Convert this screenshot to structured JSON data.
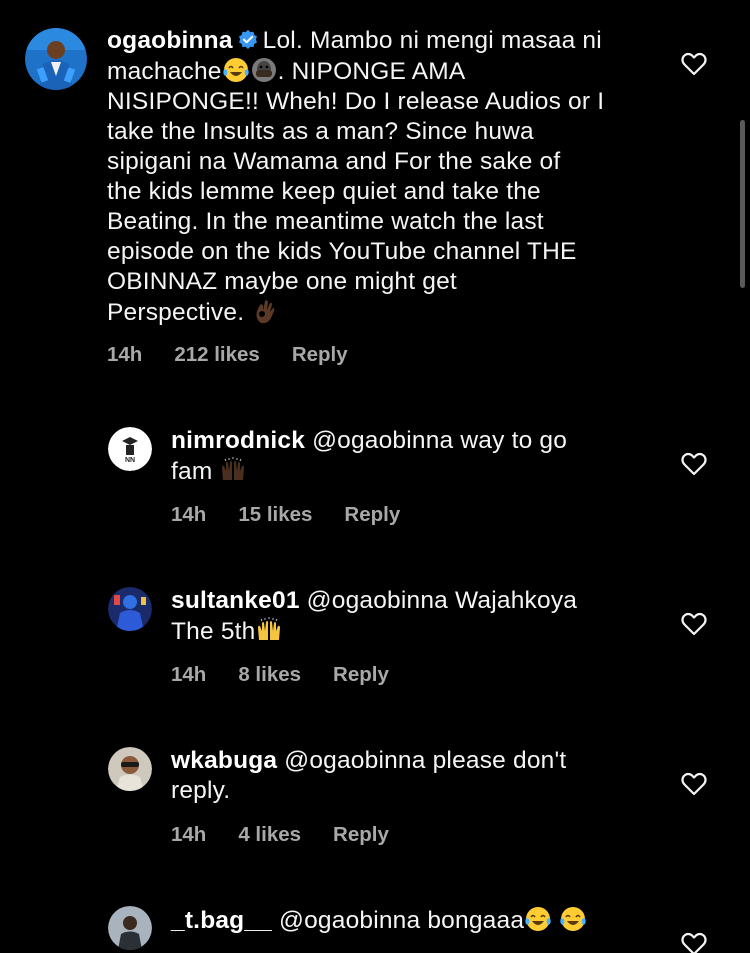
{
  "comments": [
    {
      "username": "ogaobinna",
      "verified": true,
      "text_lines": [
        "Lol. Mambo ni mengi masaa ni",
        "machache",
        ". NIPONGE AMA",
        "NISIPONGE!! Wheh! Do I release Audios or I",
        "take the Insults as a man? Since huwa",
        "sipigani na Wamama and For the sake of",
        "the kids lemme keep quiet and take the",
        "Beating. In the meantime watch the last",
        "episode on the kids YouTube channel THE",
        "OBINNAZ maybe one might get",
        "Perspective."
      ],
      "time": "14h",
      "likes": "212 likes",
      "reply": "Reply"
    },
    {
      "username": "nimrodnick",
      "mention": "@ogaobinna",
      "line1_rest": "way to go",
      "line2": "fam",
      "time": "14h",
      "likes": "15 likes",
      "reply": "Reply"
    },
    {
      "username": "sultanke01",
      "mention": "@ogaobinna",
      "line1_rest": "Wajahkoya",
      "line2": "The 5th",
      "time": "14h",
      "likes": "8 likes",
      "reply": "Reply"
    },
    {
      "username": "wkabuga",
      "mention": "@ogaobinna",
      "line1_rest": "please don't",
      "line2": "reply.",
      "time": "14h",
      "likes": "4 likes",
      "reply": "Reply"
    },
    {
      "username": "_t.bag__",
      "mention": "@ogaobinna",
      "line1_rest": "bongaaa"
    }
  ],
  "icons": {
    "like": "heart-outline-icon",
    "verified": "verified-badge-icon"
  },
  "colors": {
    "background": "#000000",
    "text": "#f5f5f5",
    "meta": "#a8a8a8",
    "verified": "#3897f0"
  }
}
